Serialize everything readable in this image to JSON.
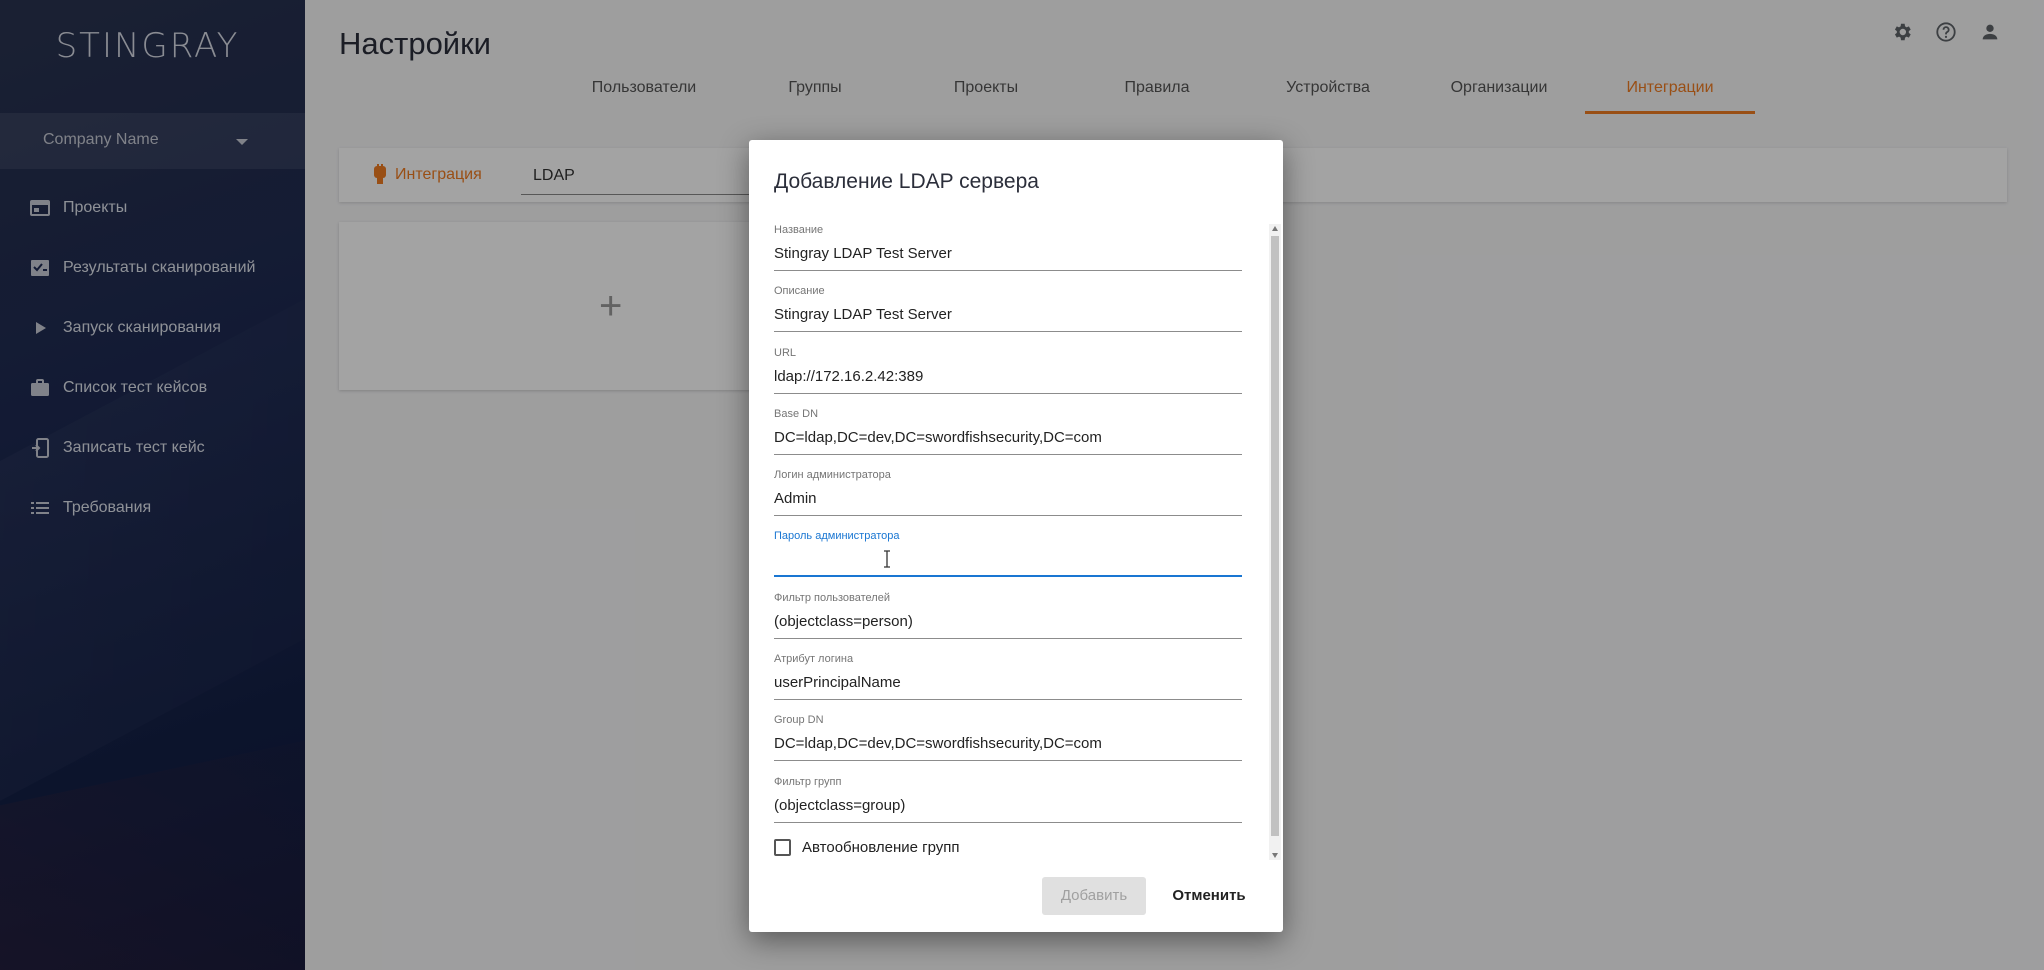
{
  "app": {
    "logo": "STINGRAY"
  },
  "sidebar": {
    "company": "Company Name",
    "items": [
      {
        "label": "Проекты",
        "icon": "projects-icon"
      },
      {
        "label": "Результаты сканирований",
        "icon": "scan-results-icon"
      },
      {
        "label": "Запуск сканирования",
        "icon": "play-icon"
      },
      {
        "label": "Список тест кейсов",
        "icon": "briefcase-icon"
      },
      {
        "label": "Записать тест кейс",
        "icon": "record-device-icon"
      },
      {
        "label": "Требования",
        "icon": "list-icon"
      }
    ]
  },
  "header": {
    "title": "Настройки",
    "icons": [
      "gear-icon",
      "help-icon",
      "user-icon"
    ]
  },
  "tabs": [
    {
      "label": "Пользователи"
    },
    {
      "label": "Группы"
    },
    {
      "label": "Проекты"
    },
    {
      "label": "Правила"
    },
    {
      "label": "Устройства"
    },
    {
      "label": "Организации"
    },
    {
      "label": "Интеграции",
      "active": true
    }
  ],
  "integration": {
    "label": "Интеграция",
    "value": "LDAP"
  },
  "card": {
    "plus": "+"
  },
  "dialog": {
    "title": "Добавление LDAP сервера",
    "fields": [
      {
        "label": "Название",
        "value": "Stingray LDAP Test Server"
      },
      {
        "label": "Описание",
        "value": "Stingray LDAP Test Server"
      },
      {
        "label": "URL",
        "value": "ldap://172.16.2.42:389"
      },
      {
        "label": "Base DN",
        "value": "DC=ldap,DC=dev,DC=swordfishsecurity,DC=com"
      },
      {
        "label": "Логин администратора",
        "value": "Admin"
      },
      {
        "label": "Пароль администратора",
        "value": ""
      },
      {
        "label": "Фильтр пользователей",
        "value": "(objectclass=person)"
      },
      {
        "label": "Атрибут логина",
        "value": "userPrincipalName"
      },
      {
        "label": "Group DN",
        "value": "DC=ldap,DC=dev,DC=swordfishsecurity,DC=com"
      },
      {
        "label": "Фильтр групп",
        "value": "(objectclass=group)"
      }
    ],
    "checkbox_label": "Автообновление групп",
    "add_label": "Добавить",
    "cancel_label": "Отменить"
  },
  "colors": {
    "accent": "#f07c22",
    "focus": "#1976d2",
    "sidebar": "#1e2a52"
  }
}
